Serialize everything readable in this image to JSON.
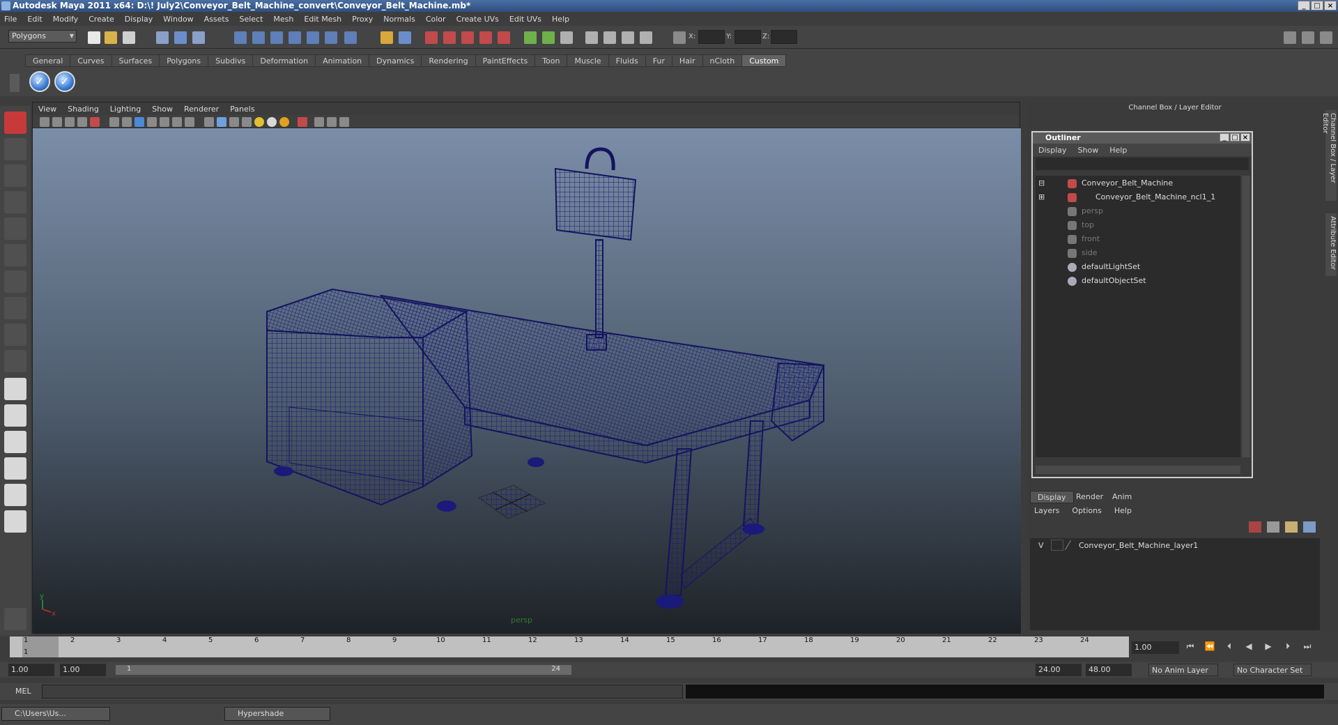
{
  "window": {
    "title": "Autodesk Maya 2011 x64: D:\\! July2\\Conveyor_Belt_Machine_convert\\Conveyor_Belt_Machine.mb*"
  },
  "menubar": [
    "File",
    "Edit",
    "Modify",
    "Create",
    "Display",
    "Window",
    "Assets",
    "Select",
    "Mesh",
    "Edit Mesh",
    "Proxy",
    "Normals",
    "Color",
    "Create UVs",
    "Edit UVs",
    "Help"
  ],
  "statusline": {
    "mode": "Polygons",
    "x_label": "X:",
    "y_label": "Y:",
    "z_label": "Z:"
  },
  "shelf": {
    "tabs": [
      "General",
      "Curves",
      "Surfaces",
      "Polygons",
      "Subdivs",
      "Deformation",
      "Animation",
      "Dynamics",
      "Rendering",
      "PaintEffects",
      "Toon",
      "Muscle",
      "Fluids",
      "Fur",
      "Hair",
      "nCloth",
      "Custom"
    ],
    "active": "Custom"
  },
  "viewport": {
    "menu": [
      "View",
      "Shading",
      "Lighting",
      "Show",
      "Renderer",
      "Panels"
    ],
    "camera": "persp",
    "axis_y": "y",
    "axis_x": "x"
  },
  "channelbox": {
    "title": "Channel Box / Layer Editor"
  },
  "outliner": {
    "title": "Outliner",
    "menu": [
      "Display",
      "Show",
      "Help"
    ],
    "items": [
      {
        "label": "Conveyor_Belt_Machine",
        "dim": false
      },
      {
        "label": "Conveyor_Belt_Machine_ncl1_1",
        "dim": false
      },
      {
        "label": "persp",
        "dim": true
      },
      {
        "label": "top",
        "dim": true
      },
      {
        "label": "front",
        "dim": true
      },
      {
        "label": "side",
        "dim": true
      },
      {
        "label": "defaultLightSet",
        "dim": false
      },
      {
        "label": "defaultObjectSet",
        "dim": false
      }
    ]
  },
  "layers": {
    "tabs": [
      "Display",
      "Render",
      "Anim"
    ],
    "menu": [
      "Layers",
      "Options",
      "Help"
    ],
    "row": {
      "visible": "V",
      "name": "Conveyor_Belt_Machine_layer1"
    }
  },
  "sidetabs": [
    "Channel Box / Layer Editor",
    "Attribute Editor"
  ],
  "timeline": {
    "ticks": [
      "1",
      "2",
      "3",
      "4",
      "5",
      "6",
      "7",
      "8",
      "9",
      "10",
      "11",
      "12",
      "13",
      "14",
      "15",
      "16",
      "17",
      "18",
      "19",
      "20",
      "21",
      "22",
      "23",
      "24"
    ],
    "current": "1.00",
    "current_marker": "1"
  },
  "range": {
    "start": "1.00",
    "start2": "1.00",
    "slider_start": "1",
    "slider_end": "24",
    "end": "24.00",
    "end2": "48.00",
    "anim_layer": "No Anim Layer",
    "char_set": "No Character Set"
  },
  "mel": {
    "label": "MEL"
  },
  "taskbar": [
    {
      "label": "C:\\Users\\Us..."
    },
    {
      "label": "Hypershade"
    }
  ],
  "colors": {
    "wire": "#1a1a7a",
    "accent": "#3a7bd5"
  }
}
